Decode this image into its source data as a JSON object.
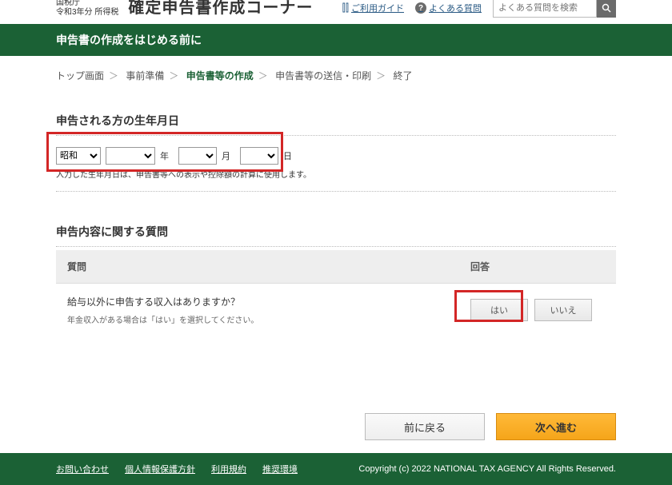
{
  "header": {
    "agency": "国税庁",
    "year_tax": "令和3年分 所得税",
    "title": "確定申告書作成コーナー",
    "guide": "ご利用ガイド",
    "faq": "よくある質問",
    "search_placeholder": "よくある質問を検索"
  },
  "green_bar": "申告書の作成をはじめる前に",
  "breadcrumb": {
    "items": [
      "トップ画面",
      "事前準備",
      "申告書等の作成",
      "申告書等の送信・印刷",
      "終了"
    ],
    "active_index": 2
  },
  "dob": {
    "title": "申告される方の生年月日",
    "era_selected": "昭和",
    "unit_year": "年",
    "unit_month": "月",
    "unit_day": "日",
    "note": "入力した生年月日は、申告書等への表示や控除額の計算に使用します。"
  },
  "qa": {
    "title": "申告内容に関する質問",
    "col_q": "質問",
    "col_a": "回答",
    "q1": "給与以外に申告する収入はありますか？",
    "q1_sub": "年金収入がある場合は「はい」を選択してください。",
    "yes": "はい",
    "no": "いいえ"
  },
  "nav": {
    "back": "前に戻る",
    "next": "次へ進む"
  },
  "footer": {
    "links": [
      "お問い合わせ",
      "個人情報保護方針",
      "利用規約",
      "推奨環境"
    ],
    "copyright": "Copyright (c) 2022 NATIONAL TAX AGENCY All Rights Reserved."
  }
}
